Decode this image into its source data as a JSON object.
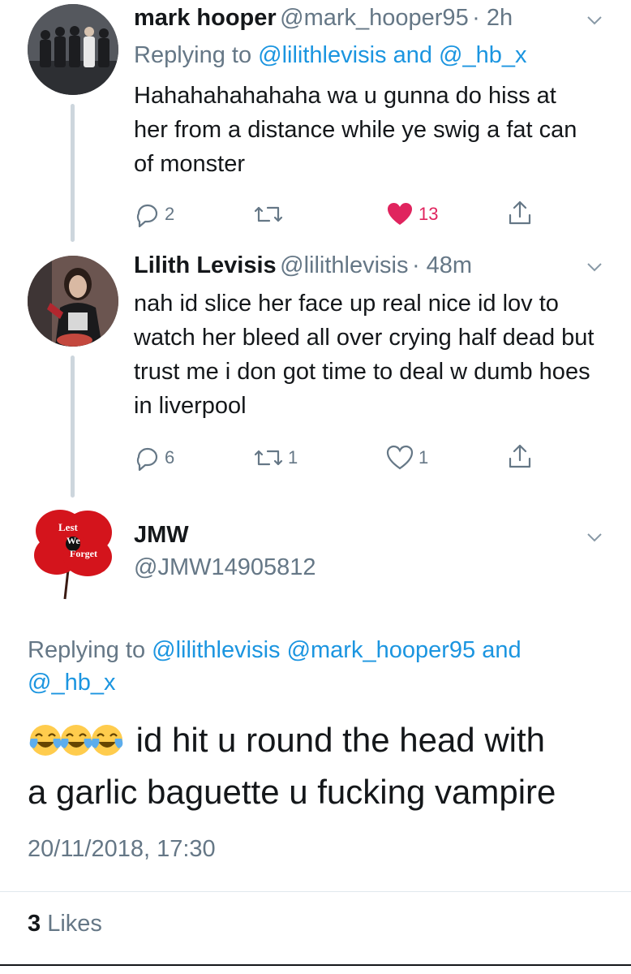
{
  "tweets": [
    {
      "name": "mark hooper",
      "handle": "@mark_hooper95",
      "time": "· 2h",
      "replying_prefix": "Replying to",
      "replying_to": "@lilithlevisis and @_hb_x",
      "text": "Hahahahahahaha wa u gunna do hiss at her from a distance while ye swig a fat can of monster",
      "actions": {
        "replies": "2",
        "retweets": "",
        "likes": "13",
        "liked": true
      }
    },
    {
      "name": "Lilith Levisis",
      "handle": "@lilithlevisis",
      "time": "· 48m",
      "text": "nah id slice her face up real nice id lov to watch her bleed all over crying half dead but trust me i don got time to deal w dumb hoes in liverpool",
      "actions": {
        "replies": "6",
        "retweets": "1",
        "likes": "1",
        "liked": false
      }
    }
  ],
  "main_tweet": {
    "name": "JMW",
    "handle": "@JMW14905812",
    "avatar_text": [
      "Lest",
      "We",
      "Forget"
    ],
    "replying_prefix": "Replying to",
    "replying_to_line1": "@lilithlevisis @mark_hooper95 and",
    "replying_to_line2": "@_hb_x",
    "emoji_count": 3,
    "text_line1": "id hit u round the head with",
    "text_line2": "a garlic baguette u fucking vampire",
    "timestamp": "20/11/2018, 17:30",
    "likes_count": "3",
    "likes_label": "Likes"
  },
  "colors": {
    "link": "#1b95e0",
    "secondary": "#657786",
    "like": "#e0245e",
    "thread_line": "#cdd6dd"
  },
  "icons": [
    "reply-icon",
    "retweet-icon",
    "heart-icon",
    "share-icon",
    "chevron-down-icon",
    "tears-of-joy-emoji"
  ]
}
